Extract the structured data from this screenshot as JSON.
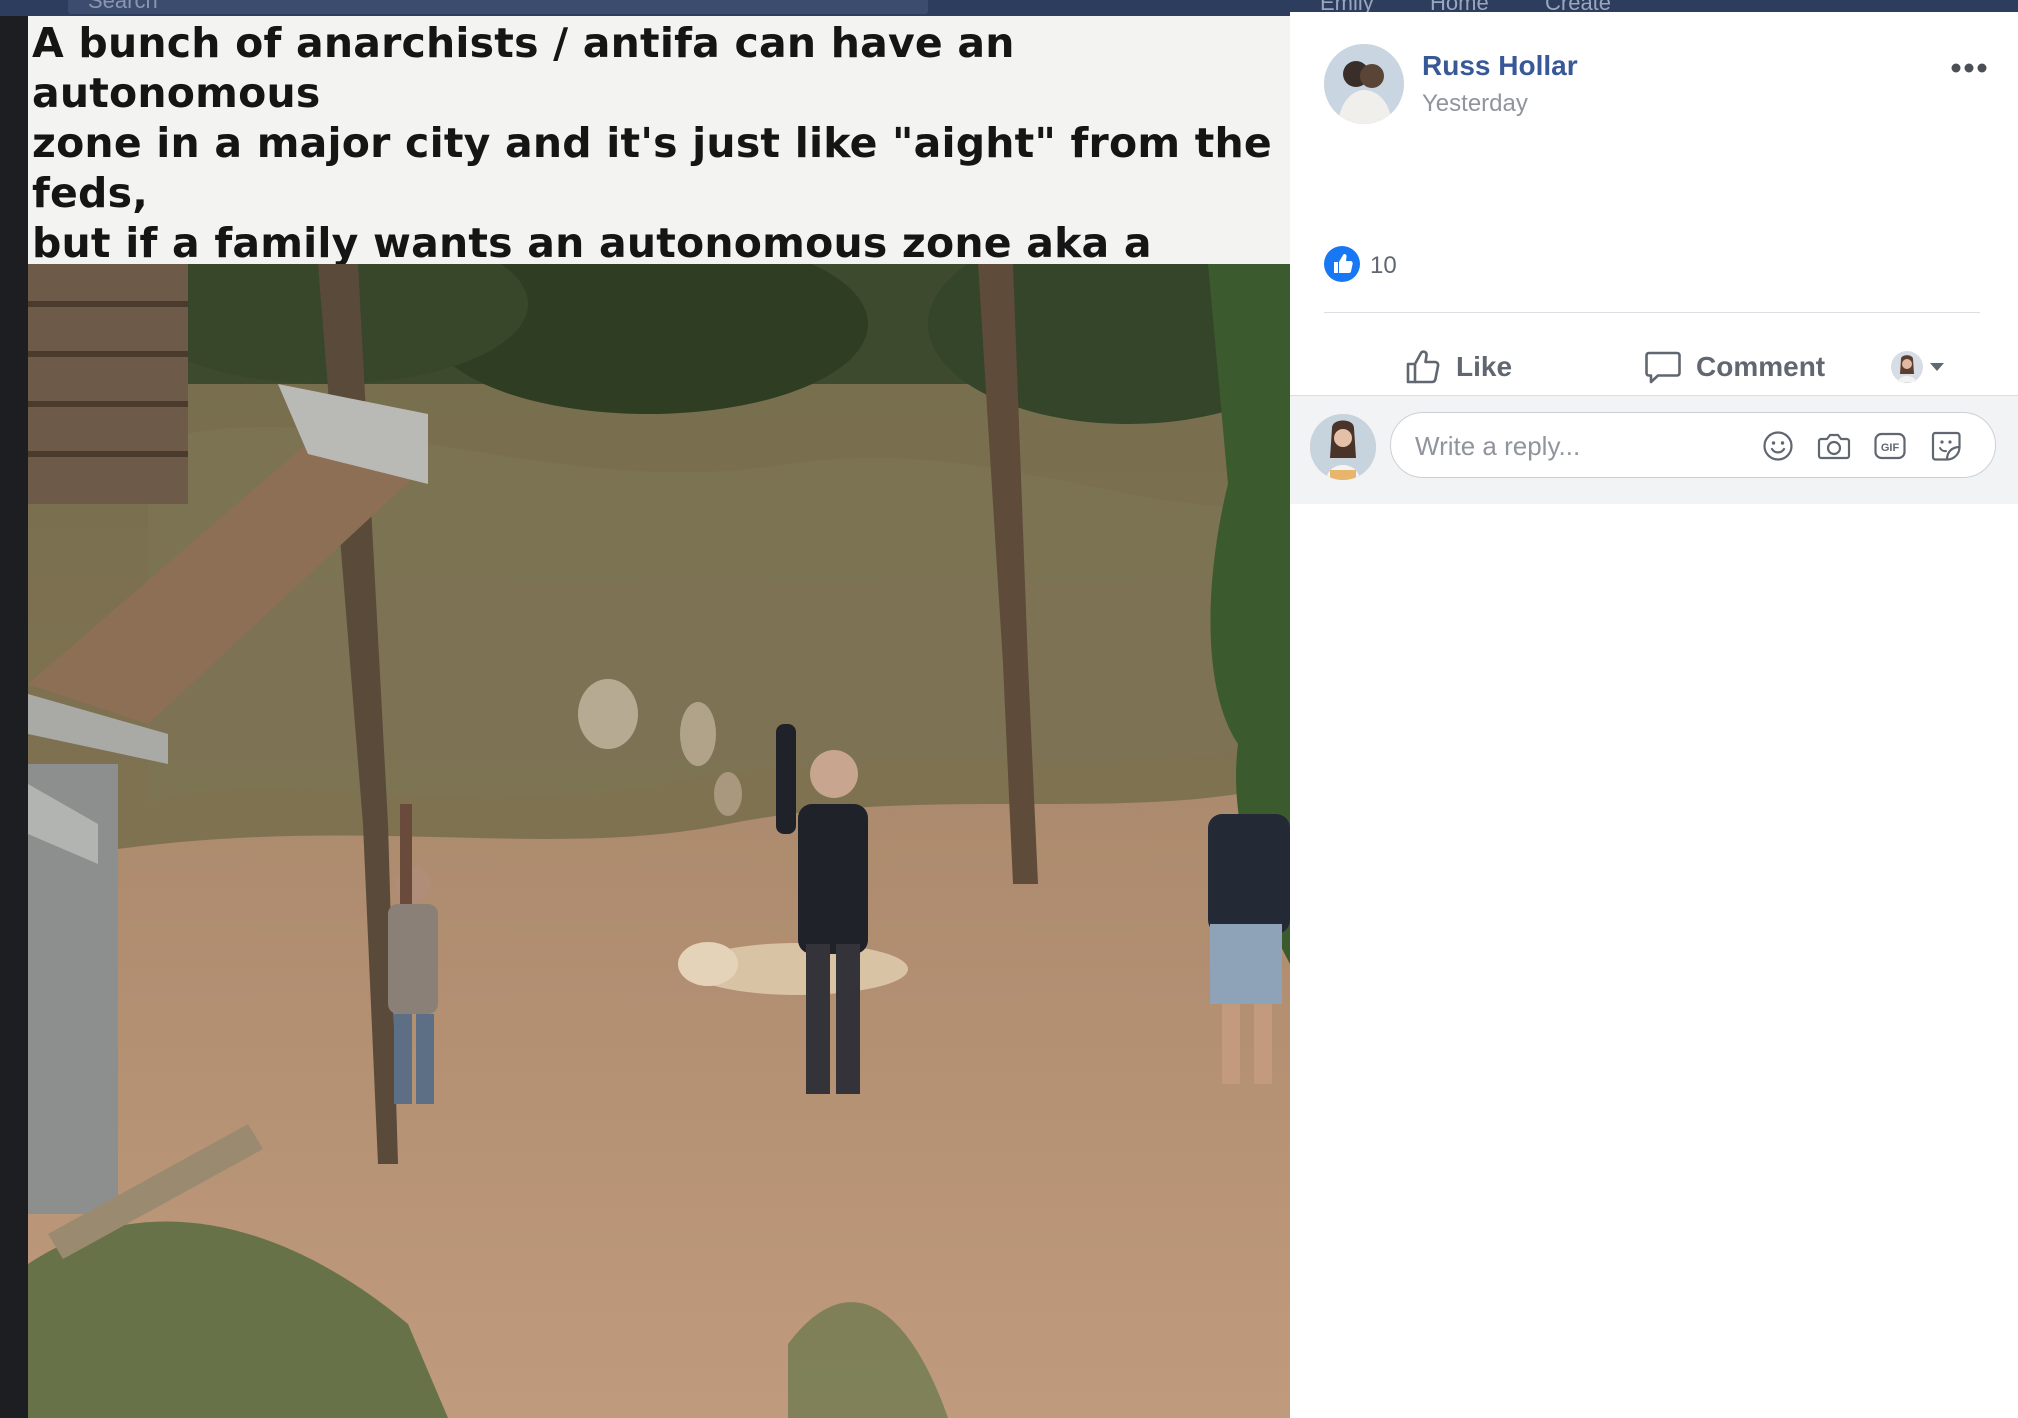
{
  "background_nav": {
    "search_placeholder": "Search",
    "nav_items": [
      "Emily",
      "Home",
      "Create"
    ]
  },
  "post": {
    "image_caption": "A bunch of anarchists / antifa can have an autonomous\nzone in a major city and it's just like \"aight\" from the feds,\nbut if a family wants an autonomous zone aka a home in\nthe middle of nowhere Idaho a FBI sniper is like \"boom your\nson dies\"",
    "author": "Russ Hollar",
    "timestamp": "Yesterday",
    "like_count": "10"
  },
  "actions": {
    "like_label": "Like",
    "comment_label": "Comment"
  },
  "reply": {
    "placeholder": "Write a reply..."
  },
  "icons": {
    "more": "more-options-icon",
    "like_badge": "thumbs-up-icon",
    "like": "thumbs-up-outline-icon",
    "comment": "speech-bubble-icon",
    "audience": "avatar-dropdown-icon",
    "emoji": "emoji-icon",
    "camera": "camera-icon",
    "gif": "gif-icon",
    "sticker": "sticker-icon"
  },
  "colors": {
    "brand_link": "#385898",
    "like_blue": "#1877f2",
    "secondary_text": "#90949c"
  }
}
